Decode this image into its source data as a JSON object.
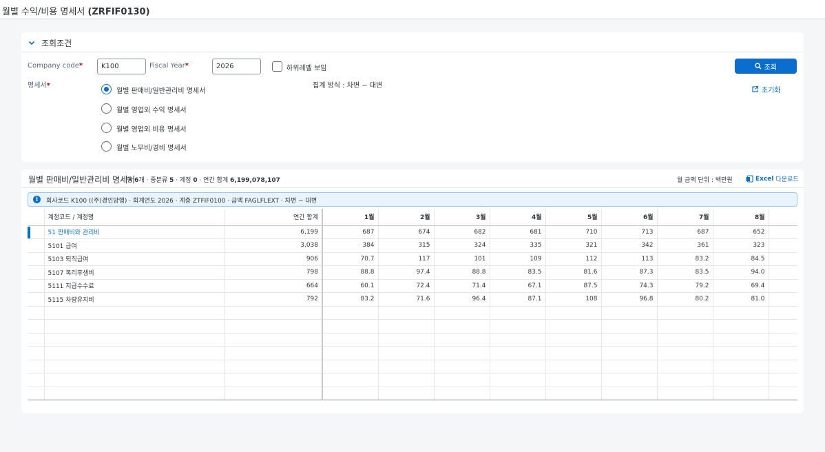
{
  "app": {
    "title_prefix": "월별 수익/비용 명세서",
    "title_code": "(ZRFIF0130)"
  },
  "filter": {
    "section_title": "조회조건",
    "company_code_label": "Company code",
    "company_code_value": "K100",
    "fiscal_year_label": "Fiscal Year",
    "fiscal_year_value": "2026",
    "show_sublevel_label": "하위레벨 보임",
    "statement_label": "명세서",
    "required_mark": "*",
    "options": [
      {
        "label": "월별 판매비/일반관리비 명세서",
        "selected": true
      },
      {
        "label": "월별 영업외 수익 명세서",
        "selected": false
      },
      {
        "label": "월별 영업외 비용 명세서",
        "selected": false
      },
      {
        "label": "월별 노무비/경비 명세서",
        "selected": false
      }
    ],
    "aggregation_text": "집계 방식 : 차변 − 대변",
    "search_button": "조회",
    "reset_button": "초기화"
  },
  "table_panel": {
    "title": "월별 판매비/일반관리비 명세서",
    "meta_rows_label": "행",
    "meta_rows_value": "6",
    "meta_rows_suffix": "개 · 중분류",
    "meta_mid_value": "5",
    "meta_mid_suffix": "· 계정",
    "meta_acct_value": "0",
    "meta_acct_suffix": "· 연간 합계",
    "meta_total_value": "6,199,078,107",
    "unit_text": "월 금액 단위 : 백만원",
    "excel_bold": "Excel",
    "excel_rest": "다운로드",
    "info_text": "회사코드 K100 ((주)경인양행) · 회계연도 2026 · 계층 ZTFIF0100 · 금액 FAGLFLEXT · 차변 − 대변"
  },
  "columns": {
    "account": "계정코드 / 계정명",
    "total": "연간 합계",
    "months": [
      "1월",
      "2월",
      "3월",
      "4월",
      "5월",
      "6월",
      "7월",
      "8월"
    ]
  },
  "rows": [
    {
      "account": "51 판매비와 관리비",
      "group": true,
      "total": "6,199",
      "months": [
        "687",
        "674",
        "682",
        "681",
        "710",
        "713",
        "687",
        "652"
      ]
    },
    {
      "account": "5101 급여",
      "group": false,
      "total": "3,038",
      "months": [
        "384",
        "315",
        "324",
        "335",
        "321",
        "342",
        "361",
        "323"
      ]
    },
    {
      "account": "5103 퇴직급여",
      "group": false,
      "total": "906",
      "months": [
        "70.7",
        "117",
        "101",
        "109",
        "112",
        "113",
        "83.2",
        "84.5"
      ]
    },
    {
      "account": "5107 복리후생비",
      "group": false,
      "total": "798",
      "months": [
        "88.8",
        "97.4",
        "88.8",
        "83.5",
        "81.6",
        "87.3",
        "83.5",
        "94.0"
      ]
    },
    {
      "account": "5111 지급수수료",
      "group": false,
      "total": "664",
      "months": [
        "60.1",
        "72.4",
        "71.4",
        "67.1",
        "87.5",
        "74.3",
        "79.2",
        "69.4"
      ]
    },
    {
      "account": "5115 차량유지비",
      "group": false,
      "total": "792",
      "months": [
        "83.2",
        "71.6",
        "96.4",
        "87.1",
        "108",
        "96.8",
        "80.2",
        "81.0"
      ]
    }
  ],
  "empty_row_count": 7,
  "colors": {
    "accent": "#0a6ed1",
    "required": "#bb0000",
    "info_bg": "#e8f3fb"
  }
}
